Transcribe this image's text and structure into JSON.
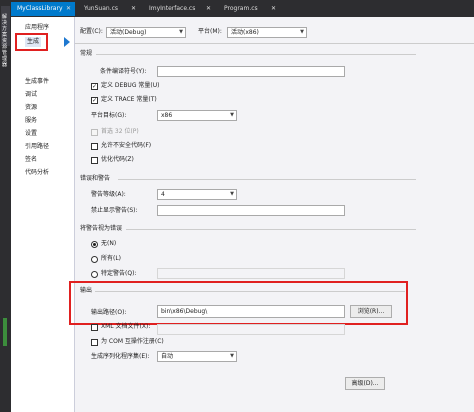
{
  "tabs": [
    {
      "label": "MyClassLibrary",
      "active": true
    },
    {
      "label": "YunSuan.cs",
      "active": false
    },
    {
      "label": "ImyInterface.cs",
      "active": false
    },
    {
      "label": "Program.cs",
      "active": false
    }
  ],
  "side_panel_label": "解决方案资源管理器",
  "sidebar": {
    "items": [
      "应用程序",
      "生成",
      "生成事件",
      "调试",
      "资源",
      "服务",
      "设置",
      "引用路径",
      "签名",
      "代码分析"
    ]
  },
  "config": {
    "config_label": "配置(C):",
    "config_value": "活动(Debug)",
    "platform_label": "平台(M):",
    "platform_value": "活动(x86)"
  },
  "general": {
    "heading": "常规",
    "cond_symbols_label": "条件编译符号(Y):",
    "cond_symbols_value": "",
    "define_debug": "定义 DEBUG 常量(U)",
    "define_trace": "定义 TRACE 常量(T)",
    "platform_target_label": "平台目标(G):",
    "platform_target_value": "x86",
    "prefer32": "首选 32 位(P)",
    "unsafe": "允许不安全代码(F)",
    "optimize": "优化代码(Z)"
  },
  "errors": {
    "heading": "错误和警告",
    "warning_level_label": "警告等级(A):",
    "warning_level_value": "4",
    "suppress_label": "禁止显示警告(S):",
    "suppress_value": ""
  },
  "treat_warnings": {
    "heading": "将警告视为错误",
    "none": "无(N)",
    "all": "所有(L)",
    "specific": "特定警告(Q):"
  },
  "output": {
    "heading": "输出",
    "path_label": "输出路径(O):",
    "path_value": "bin\\x86\\Debug\\",
    "browse_label": "浏览(R)...",
    "xml_doc": "XML 文档文件(X):",
    "com_interop": "为 COM 互操作注册(C)",
    "serialization_label": "生成序列化程序集(E):",
    "serialization_value": "自动"
  },
  "advanced_label": "高级(D)..."
}
